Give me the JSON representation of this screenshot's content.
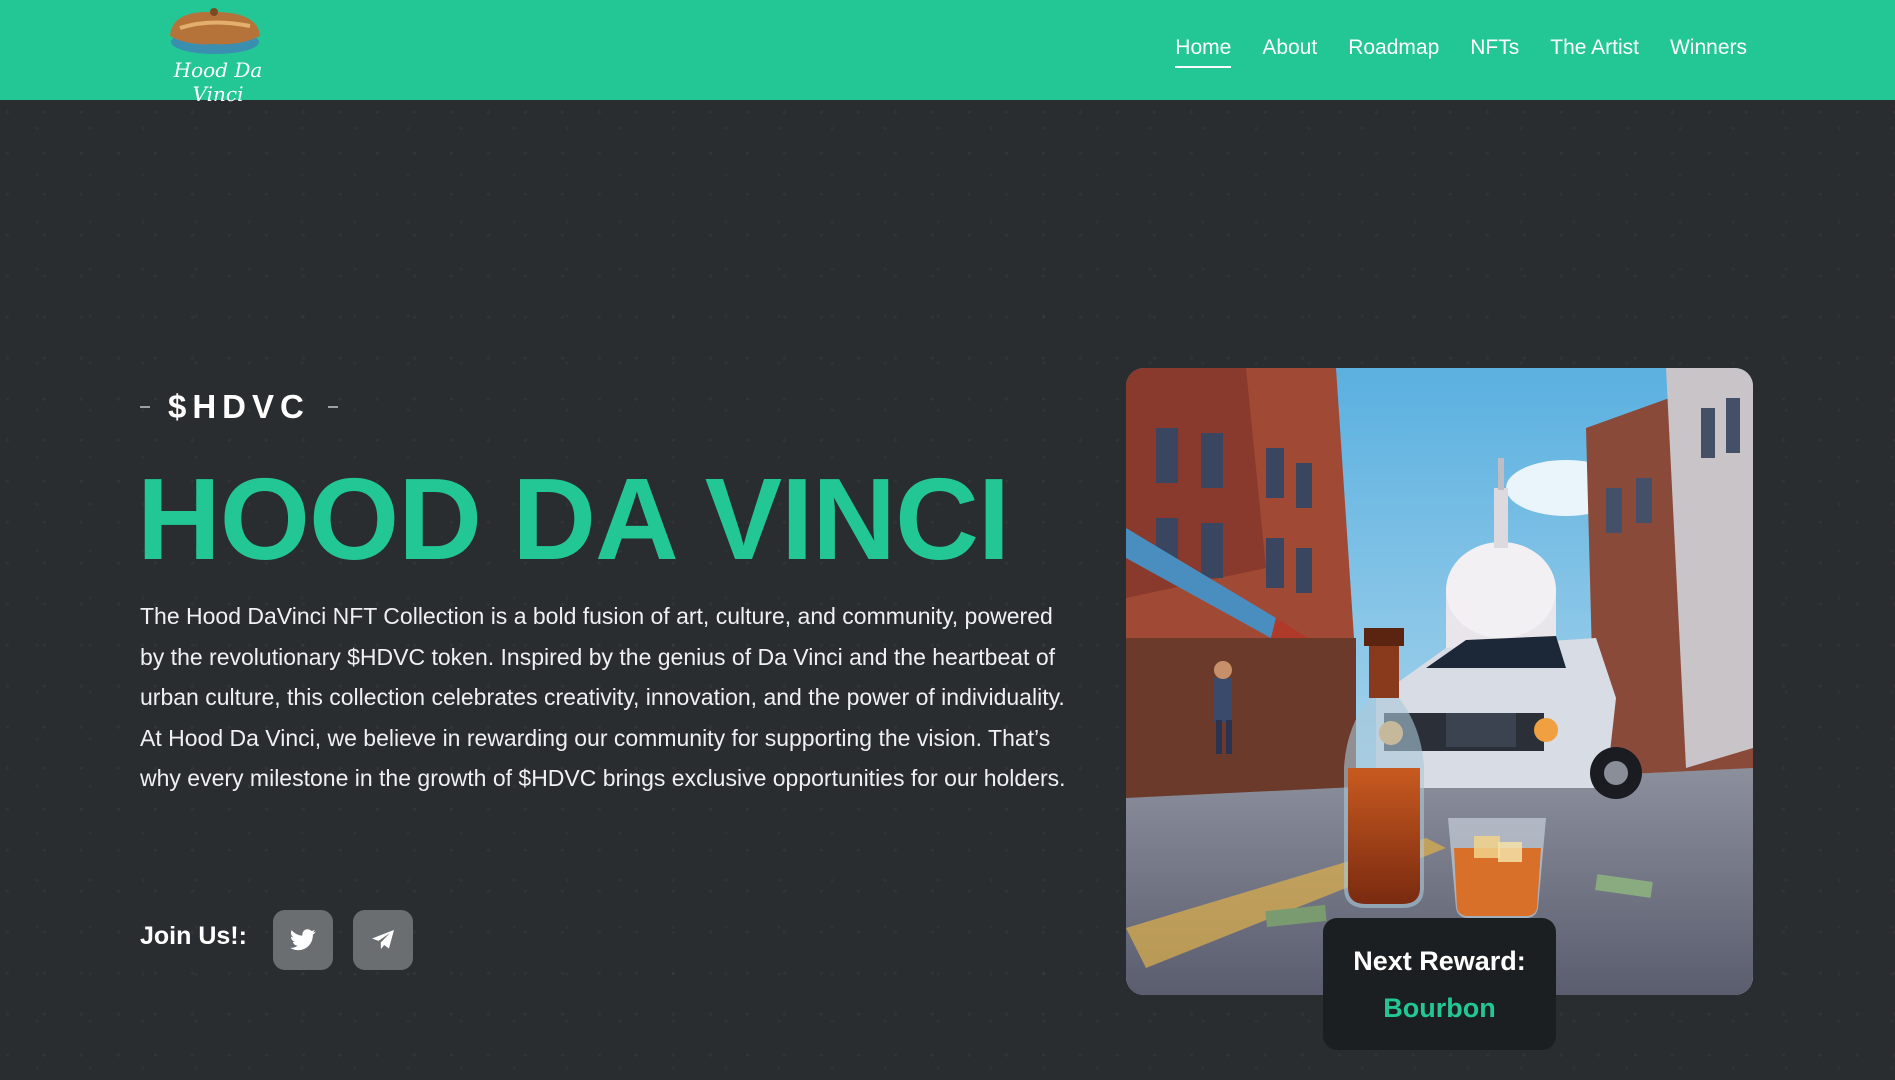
{
  "colors": {
    "accent": "#22c795",
    "background": "#2a2d2f",
    "text": "#ffffff",
    "button": "#6b6e70",
    "card": "#1c1f21"
  },
  "header": {
    "logo_text": "Hood Da Vinci",
    "nav": [
      {
        "label": "Home",
        "active": true
      },
      {
        "label": "About",
        "active": false
      },
      {
        "label": "Roadmap",
        "active": false
      },
      {
        "label": "NFTs",
        "active": false
      },
      {
        "label": "The Artist",
        "active": false
      },
      {
        "label": "Winners",
        "active": false
      }
    ]
  },
  "hero": {
    "ticker": "$HDVC",
    "title": "HOOD DA VINCI",
    "paragraph1": "The Hood DaVinci NFT Collection is a bold fusion of art, culture, and community, powered by the revolutionary $HDVC token. Inspired by the genius of Da Vinci and the heartbeat of urban culture, this collection celebrates creativity, innovation, and the power of individuality.",
    "paragraph2": "At Hood Da Vinci, we believe in rewarding our community for supporting the vision. That’s why every milestone in the growth of $HDVC brings exclusive opportunities for our holders.",
    "join_label": "Join Us!:",
    "socials": [
      {
        "icon": "twitter-icon"
      },
      {
        "icon": "telegram-icon"
      }
    ]
  },
  "reward": {
    "label": "Next Reward:",
    "value": "Bourbon"
  }
}
